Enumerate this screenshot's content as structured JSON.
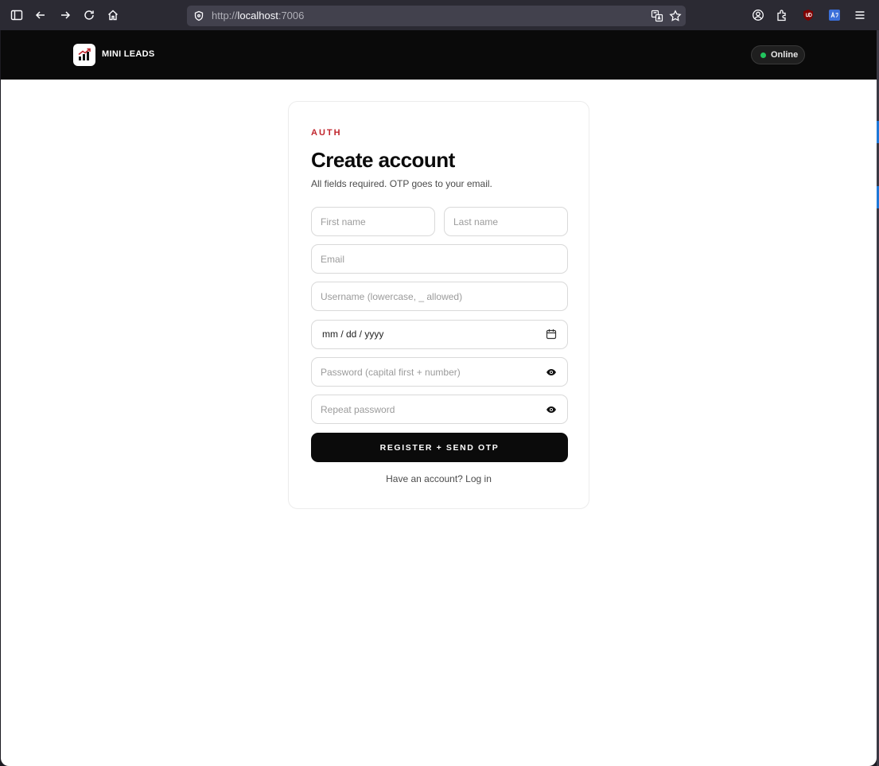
{
  "browser": {
    "url_scheme": "http://",
    "url_host": "localhost",
    "url_port": ":7006"
  },
  "header": {
    "brand": "MINI LEADS",
    "status": "Online",
    "status_color": "#22c55e"
  },
  "auth": {
    "eyebrow": "AUTH",
    "title": "Create account",
    "subtitle": "All fields required. OTP goes to your email.",
    "first_name_placeholder": "First name",
    "last_name_placeholder": "Last name",
    "email_placeholder": "Email",
    "username_placeholder": "Username (lowercase, _ allowed)",
    "date_placeholder": "mm / dd / yyyy",
    "password_placeholder": "Password (capital first + number)",
    "repeat_password_placeholder": "Repeat password",
    "submit_label": "REGISTER + SEND OTP",
    "login_prompt": "Have an account? Log in"
  },
  "colors": {
    "accent": "#c0262d",
    "primary": "#0b0b0b"
  }
}
